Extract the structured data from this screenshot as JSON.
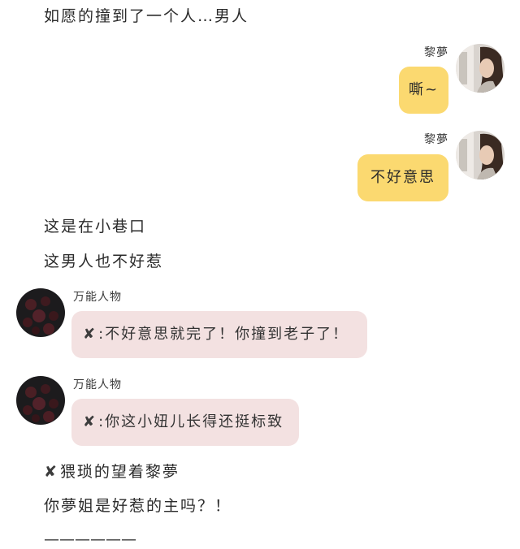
{
  "narration": {
    "line1": "如愿的撞到了一个人…男人",
    "line2": "这是在小巷口",
    "line3": "这男人也不好惹",
    "line4_mark": "✘",
    "line4_text": "猥琐的望着黎夢",
    "line5": "你夢姐是好惹的主吗？！",
    "divider": "——————"
  },
  "messages": [
    {
      "side": "right",
      "sender": "黎夢",
      "text": "嘶~",
      "bubble_color": "#fbd970",
      "avatar": "woman-portrait-avatar"
    },
    {
      "side": "right",
      "sender": "黎夢",
      "text": "不好意思",
      "bubble_color": "#fbd970",
      "avatar": "woman-portrait-avatar"
    },
    {
      "side": "left",
      "sender": "万能人物",
      "mark": "✘",
      "text": ":不好意思就完了！你撞到老子了！",
      "bubble_color": "#f3e1e1",
      "avatar": "dark-roses-avatar"
    },
    {
      "side": "left",
      "sender": "万能人物",
      "mark": "✘",
      "text": ":你这小妞儿长得还挺标致",
      "bubble_color": "#f3e1e1",
      "avatar": "dark-roses-avatar"
    }
  ],
  "colors": {
    "yellow_bubble": "#fbd970",
    "pink_bubble": "#f3e1e1",
    "text": "#2b2b2b"
  }
}
